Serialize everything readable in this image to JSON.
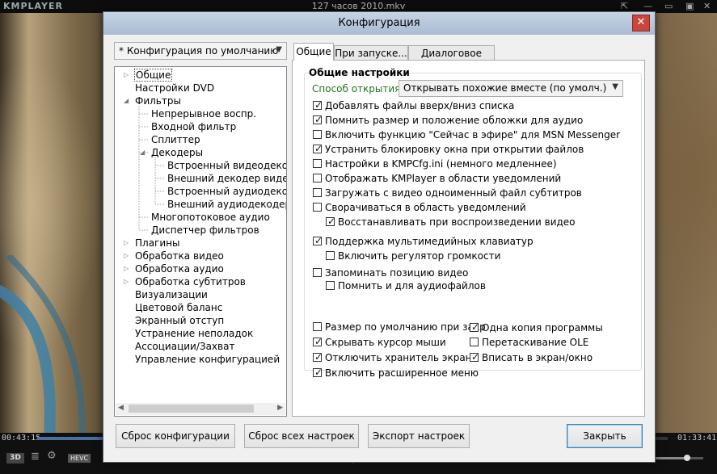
{
  "player": {
    "app_name": "KMPLAYER",
    "file_title": "127 часов 2010.mkv",
    "time_current": "00:43:15",
    "time_total": "01:33:41",
    "progress": 0.462,
    "badge_3d": "3D",
    "badge_codec": "HEVC",
    "volume": 0.75
  },
  "dialog": {
    "title": "Конфигурация",
    "close_symbol": "✕",
    "profile_select": "* Конфигурация по умолчанию",
    "tree": [
      {
        "label": "Общие",
        "level": 0,
        "arrow": "collapsed",
        "selected": true
      },
      {
        "label": "Настройки DVD",
        "level": 0,
        "arrow": "none"
      },
      {
        "label": "Фильтры",
        "level": 0,
        "arrow": "expanded"
      },
      {
        "label": "Непрерывное воспр.",
        "level": 1,
        "arrow": "none"
      },
      {
        "label": "Входной фильтр",
        "level": 1,
        "arrow": "none"
      },
      {
        "label": "Сплиттер",
        "level": 1,
        "arrow": "none"
      },
      {
        "label": "Декодеры",
        "level": 1,
        "arrow": "expanded"
      },
      {
        "label": "Встроенный видеодекоде",
        "level": 2,
        "arrow": "none"
      },
      {
        "label": "Внешний декодер видео",
        "level": 2,
        "arrow": "none"
      },
      {
        "label": "Встроенный аудиодекоде",
        "level": 2,
        "arrow": "none"
      },
      {
        "label": "Внешний аудиодекодер",
        "level": 2,
        "arrow": "none"
      },
      {
        "label": "Многопотоковое аудио",
        "level": 1,
        "arrow": "none"
      },
      {
        "label": "Диспетчер фильтров",
        "level": 1,
        "arrow": "none"
      },
      {
        "label": "Плагины",
        "level": 0,
        "arrow": "collapsed"
      },
      {
        "label": "Обработка видео",
        "level": 0,
        "arrow": "collapsed"
      },
      {
        "label": "Обработка аудио",
        "level": 0,
        "arrow": "collapsed"
      },
      {
        "label": "Обработка субтитров",
        "level": 0,
        "arrow": "collapsed"
      },
      {
        "label": "Визуализации",
        "level": 0,
        "arrow": "none"
      },
      {
        "label": "Цветовой баланс",
        "level": 0,
        "arrow": "none"
      },
      {
        "label": "Экранный отступ",
        "level": 0,
        "arrow": "none"
      },
      {
        "label": "Устранение неполадок",
        "level": 0,
        "arrow": "none"
      },
      {
        "label": "Ассоциации/Захват",
        "level": 0,
        "arrow": "none"
      },
      {
        "label": "Управление конфигурацией",
        "level": 0,
        "arrow": "none"
      }
    ],
    "tabs": [
      "Общие",
      "При запуске...",
      "Диалоговое окно"
    ],
    "active_tab": 0,
    "group_title": "Общие настройки",
    "open_mode_label": "Способ открытия:",
    "open_mode_value": "Открывать похожие вместе (по умолч.)",
    "checkboxes": [
      {
        "label": "Добавлять файлы вверх/вниз списка",
        "checked": true,
        "indent": 0
      },
      {
        "label": "Помнить размер и положение обложки для аудио",
        "checked": true,
        "indent": 0
      },
      {
        "label": "Включить функцию \"Сейчас в эфире\" для MSN Messenger",
        "checked": false,
        "indent": 0
      },
      {
        "label": "Устранить блокировку окна при открытии файлов",
        "checked": true,
        "indent": 0
      },
      {
        "label": "Настройки в KMPCfg.ini (немного медленнее)",
        "checked": false,
        "indent": 0
      },
      {
        "label": "Отображать KMPlayer в области уведомлений",
        "checked": false,
        "indent": 0
      },
      {
        "label": "Загружать с видео одноименный файл субтитров",
        "checked": false,
        "indent": 0
      },
      {
        "label": "Сворачиваться в область уведомлений",
        "checked": false,
        "indent": 0
      },
      {
        "label": "Восстанавливать при воспроизведении видео",
        "checked": true,
        "indent": 1
      },
      {
        "label": "Поддержка мультимедийных клавиатур",
        "checked": true,
        "indent": 0
      },
      {
        "label": "Включить регулятор громкости",
        "checked": false,
        "indent": 1
      },
      {
        "label": "Запоминать позицию видео",
        "checked": false,
        "indent": 0
      },
      {
        "label": "Помнить и для аудиофайлов",
        "checked": false,
        "indent": 1
      }
    ],
    "left_checkboxes": [
      {
        "label": "Размер по умолчанию при закр",
        "checked": false
      },
      {
        "label": "Скрывать курсор мыши",
        "checked": true
      },
      {
        "label": "Отключить хранитель экрана",
        "checked": true
      },
      {
        "label": "Включить расширенное меню",
        "checked": true
      }
    ],
    "right_checkboxes": [
      {
        "label": "Одна копия программы",
        "checked": true
      },
      {
        "label": "Перетаскивание OLE",
        "checked": false
      },
      {
        "label": "Вписать в экран/окно",
        "checked": true
      }
    ],
    "buttons": {
      "reset_config": "Сброс конфигурации",
      "reset_all": "Сброс всех настроек",
      "export": "Экспорт настроек",
      "close": "Закрыть"
    }
  }
}
